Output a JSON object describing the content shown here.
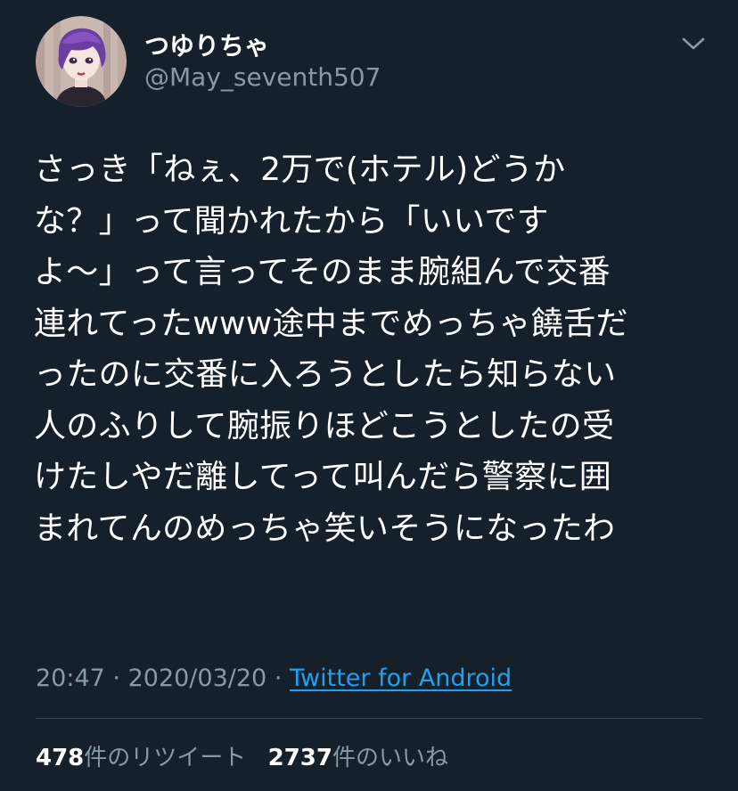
{
  "tweet": {
    "display_name": "つゆりちゃ",
    "handle": "@May_seventh507",
    "text_lines": [
      "さっき「ねぇ、2万で(ホテル)どうか",
      "な？」って聞かれたから「いいです",
      "よ〜」って言ってそのまま腕組んで交番",
      "連れてったwww途中までめっちゃ饒舌だ",
      "ったのに交番に入ろうとしたら知らない",
      "人のふりして腕振りほどこうとしたの受",
      "けたしやだ離してって叫んだら警察に囲",
      "まれてんのめっちゃ笑いそうになったわ"
    ],
    "time": "20:47",
    "date": "2020/03/20",
    "separator": "·",
    "source": "Twitter for Android",
    "retweets_count": "478",
    "retweets_label": "件のリツイート",
    "likes_count": "2737",
    "likes_label": "件のいいね"
  },
  "icons": {
    "avatar": "avatar-illustration",
    "menu": "chevron-down-icon"
  },
  "colors": {
    "background": "#15202b",
    "primary_text": "#ffffff",
    "secondary_text": "#8899a6",
    "link": "#1da1f2",
    "divider": "#38444d"
  }
}
